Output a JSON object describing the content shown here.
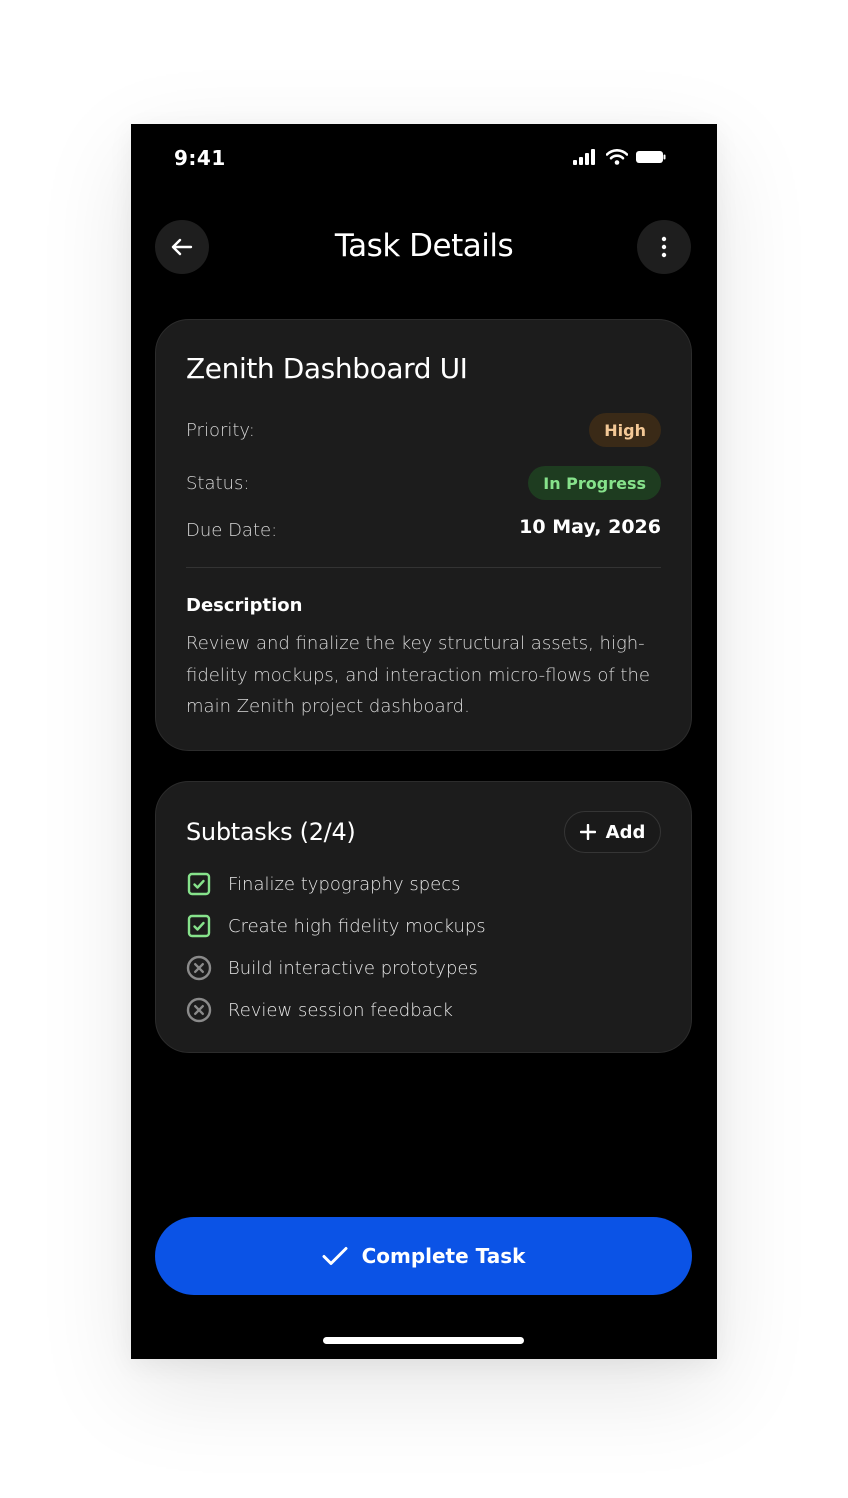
{
  "status_bar": {
    "time": "9:41"
  },
  "header": {
    "title": "Task Details"
  },
  "task": {
    "name": "Zenith Dashboard UI",
    "priority_label": "Priority:",
    "priority_value": "High",
    "status_label": "Status:",
    "status_value": "In Progress",
    "due_label": "Due Date:",
    "due_value": "10 May, 2026",
    "description_title": "Description",
    "description": "Review and finalize the key structural assets, high-fidelity mockups, and interaction micro-flows of the main Zenith project dashboard."
  },
  "subtasks": {
    "title": "Subtasks (2/4)",
    "add_label": "Add",
    "items": [
      {
        "label": "Finalize typography specs",
        "done": true
      },
      {
        "label": "Create high fidelity mockups",
        "done": true
      },
      {
        "label": "Build interactive prototypes",
        "done": false
      },
      {
        "label": "Review session feedback",
        "done": false
      }
    ]
  },
  "footer": {
    "complete_label": "Complete Task"
  },
  "colors": {
    "background": "#000000",
    "card": "#1c1c1c",
    "accent": "#0b53e6",
    "priority_high_bg": "#3a2a17",
    "priority_high_text": "#f3c896",
    "status_progress_bg": "#1e3c20",
    "status_progress_text": "#86e28b",
    "done_check": "#86e28b",
    "pending_icon": "#8a8a8a"
  },
  "icons": [
    "signal-icon",
    "wifi-icon",
    "battery-icon",
    "back-arrow-icon",
    "more-vertical-icon",
    "plus-icon",
    "checkbox-checked-icon",
    "circle-x-icon",
    "check-icon"
  ]
}
